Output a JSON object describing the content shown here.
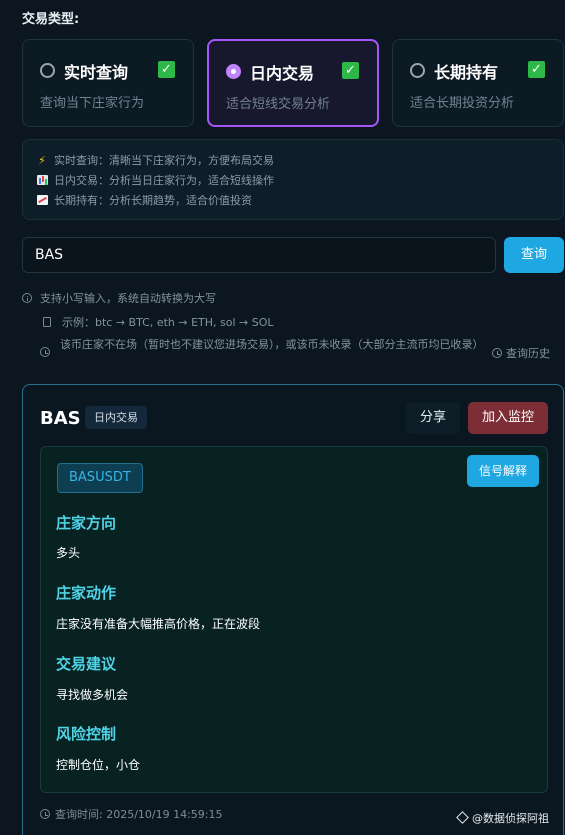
{
  "trade_type_label": "交易类型:",
  "trade_types": [
    {
      "title": "实时查询",
      "desc": "查询当下庄家行为",
      "selected": false
    },
    {
      "title": "日内交易",
      "desc": "适合短线交易分析",
      "selected": true
    },
    {
      "title": "长期持有",
      "desc": "适合长期投资分析",
      "selected": false
    }
  ],
  "check_mark": "✓",
  "info_lines": [
    {
      "icon": "lightning-icon",
      "text": "实时查询：清晰当下庄家行为，方便布局交易"
    },
    {
      "icon": "bar-chart-icon",
      "text": "日内交易：分析当日庄家行为，适合短线操作"
    },
    {
      "icon": "trend-chart-icon",
      "text": "长期持有：分析长期趋势，适合价值投资"
    }
  ],
  "search": {
    "value": "BAS",
    "button_label": "查询"
  },
  "hints": {
    "lowercase": "支持小写输入，系统自动转换为大写",
    "example": "示例：btc → BTC, eth → ETH, sol → SOL",
    "notice": "该币庄家不在场（暂时也不建议您进场交易），或该币未收录（大部分主流币均已收录）",
    "history": "查询历史"
  },
  "result": {
    "coin": "BAS",
    "mode": "日内交易",
    "share_label": "分享",
    "monitor_label": "加入监控",
    "pair": "BASUSDT",
    "explain_label": "信号解释",
    "sections": [
      {
        "heading": "庄家方向",
        "value": "多头"
      },
      {
        "heading": "庄家动作",
        "value": "庄家没有准备大幅推高价格，正在波段"
      },
      {
        "heading": "交易建议",
        "value": "寻找做多机会"
      },
      {
        "heading": "风险控制",
        "value": "控制仓位，小仓"
      }
    ],
    "query_time": "查询时间: 2025/10/19 14:59:15"
  },
  "watermark": "@数据侦探阿祖",
  "colors": {
    "accent_blue": "#1ea7e0",
    "accent_purple": "#a855f7",
    "signal_heading": "#4fd3e6",
    "monitor_red": "#7d2d36",
    "check_green": "#2fb84a"
  }
}
